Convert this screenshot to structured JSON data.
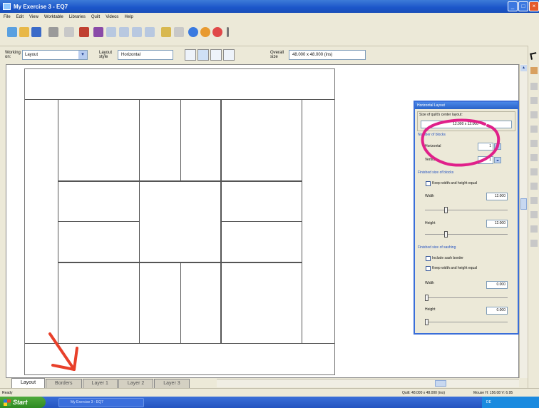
{
  "window": {
    "title": "My Exercise 3 - EQ7"
  },
  "menu": [
    "File",
    "Edit",
    "View",
    "Worktable",
    "Libraries",
    "Quilt",
    "Videos",
    "Help"
  ],
  "propbar": {
    "working_on_label": "Working on:",
    "working_on_value": "Layout",
    "layout_style_label": "Layout style",
    "layout_style_value": "Horizontal",
    "overall_size_label": "Overall size",
    "overall_size_value": "48.000 x 48.000 (ins)"
  },
  "panel": {
    "title": "Horizontal Layout",
    "size_label": "Size of quilt's center layout:",
    "size_value": "12.000 x 12.000",
    "num_blocks_label": "Number of blocks",
    "horizontal_label": "Horizontal",
    "horizontal_value": "1",
    "vertical_label": "Vertical",
    "vertical_value": "1",
    "finished_blocks_label": "Finished size of blocks",
    "keep_equal_label": "Keep width and height equal",
    "width_label": "Width",
    "width_value": "12.000",
    "height_label": "Height",
    "height_value": "12.000",
    "sashing_label": "Finished size of sashing",
    "include_sash_label": "Include sash border",
    "keep_equal_sash_label": "Keep width and height equal",
    "sash_width_label": "Width",
    "sash_width_value": "0.000",
    "sash_height_label": "Height",
    "sash_height_value": "0.000"
  },
  "tabs": [
    "Layout",
    "Borders",
    "Layer 1",
    "Layer 2",
    "Layer 3"
  ],
  "status": {
    "ready": "Ready",
    "quilt_size": "Quilt: 48.000 x 48.000 (ins)",
    "mouse": "Mouse H: 156.08 V: 6.95"
  },
  "taskbar": {
    "start": "Start",
    "item": "My Exercise 3 - EQ7",
    "tray": "DE"
  },
  "colors": {
    "titlebar": "#1b55c9",
    "annotation": "#e0208a",
    "arrow": "#e8402a"
  }
}
